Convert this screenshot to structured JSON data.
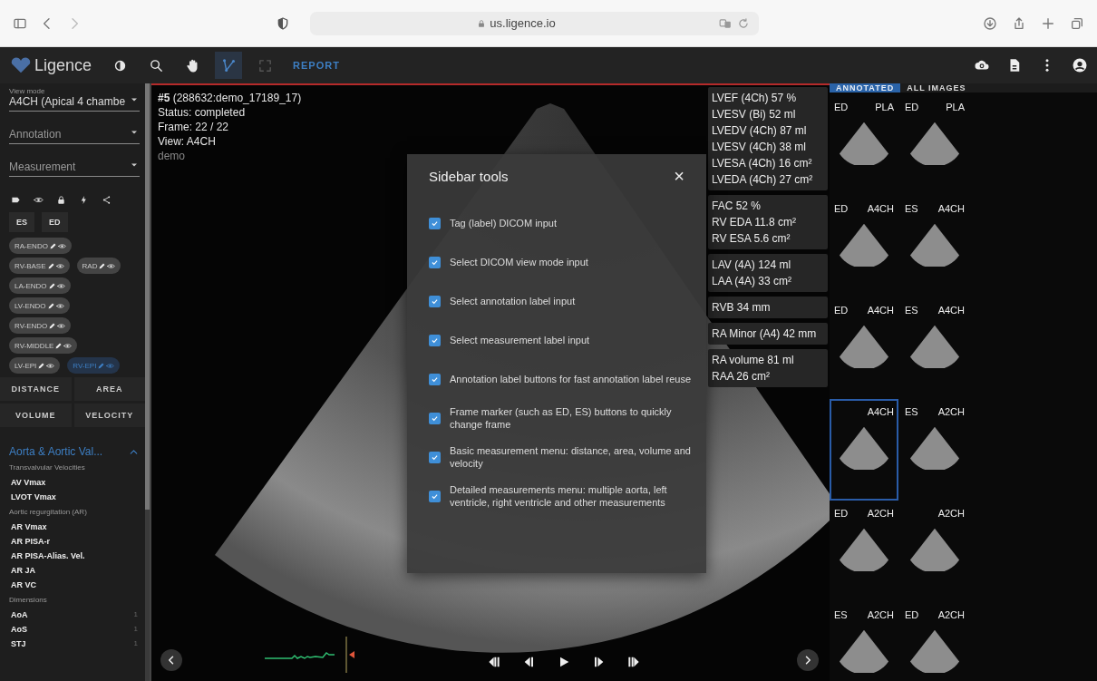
{
  "browser": {
    "address": "us.ligence.io"
  },
  "toolbar": {
    "logo": "Ligence",
    "tools": [
      {
        "kind": "contrast",
        "selected": false,
        "disabled": false
      },
      {
        "kind": "zoom",
        "selected": false,
        "disabled": false
      },
      {
        "kind": "hand",
        "selected": false,
        "disabled": false
      },
      {
        "kind": "polyline",
        "selected": true,
        "disabled": false
      },
      {
        "kind": "expand",
        "selected": false,
        "disabled": true
      }
    ],
    "report": "REPORT"
  },
  "sidebar": {
    "view_mode": {
      "label": "View mode",
      "value": "A4CH (Apical 4 chambe"
    },
    "annotation": {
      "placeholder": "Annotation"
    },
    "measurement": {
      "placeholder": "Measurement"
    },
    "frame_buttons": [
      "ES",
      "ED"
    ],
    "chip_rows": [
      [
        {
          "label": "RA-ENDO",
          "selected": false
        }
      ],
      [
        {
          "label": "RV-BASE",
          "selected": false
        },
        {
          "label": "RAD",
          "selected": false
        }
      ],
      [
        {
          "label": "LA-ENDO",
          "selected": false
        }
      ],
      [
        {
          "label": "LV-ENDO",
          "selected": false
        }
      ],
      [
        {
          "label": "RV-ENDO",
          "selected": false
        }
      ],
      [
        {
          "label": "RV-MIDDLE",
          "selected": false
        }
      ],
      [
        {
          "label": "LV-EPI",
          "selected": false
        },
        {
          "label": "RV-EPI",
          "selected": true
        }
      ]
    ],
    "measure_buttons": [
      "DISTANCE",
      "AREA",
      "VOLUME",
      "VELOCITY"
    ],
    "section": {
      "title": "Aorta & Aortic Val...",
      "expanded": true,
      "groups": [
        {
          "title": "Transvalvular Velocities",
          "items": [
            {
              "label": "AV Vmax"
            },
            {
              "label": "LVOT Vmax"
            }
          ]
        },
        {
          "title": "Aortic regurgitation (AR)",
          "items": [
            {
              "label": "AR Vmax"
            },
            {
              "label": "AR PISA-r"
            },
            {
              "label": "AR PISA-Alias. Vel."
            },
            {
              "label": "AR JA"
            },
            {
              "label": "AR VC"
            }
          ]
        },
        {
          "title": "Dimensions",
          "items": [
            {
              "label": "AoA",
              "count": "1"
            },
            {
              "label": "AoS",
              "count": "1"
            },
            {
              "label": "STJ",
              "count": "1"
            }
          ]
        }
      ]
    }
  },
  "viewer": {
    "info": [
      "**#5** (288632:demo_17189_17)",
      "Status: completed",
      "Frame: 22 / 22",
      "View: A4CH"
    ],
    "tag": "demo",
    "metrics": [
      [
        "LVEF (4Ch) 57 %",
        "LVESV (Bi) 52 ml",
        "LVEDV (4Ch) 87 ml",
        "LVESV (4Ch) 38 ml",
        "LVESA (4Ch) 16 cm²",
        "LVEDA (4Ch) 27 cm²"
      ],
      [
        "FAC 52 %",
        "RV EDA 11.8 cm²",
        "RV ESA 5.6 cm²"
      ],
      [
        "LAV (4A) 124 ml",
        "LAA (4A) 33 cm²"
      ],
      [
        "RVB 34 mm"
      ],
      [
        "RA Minor (A4) 42 mm"
      ],
      [
        "RA volume 81 ml",
        "RAA 26 cm²"
      ]
    ]
  },
  "dialog": {
    "title": "Sidebar tools",
    "close": "×",
    "options": [
      {
        "label": "Tag (label) DICOM input",
        "checked": true
      },
      {
        "label": "Select DICOM view mode input",
        "checked": true
      },
      {
        "label": "Select annotation label input",
        "checked": true
      },
      {
        "label": "Select measurement label input",
        "checked": true
      },
      {
        "label": "Annotation label buttons for fast annotation label reuse",
        "checked": true
      },
      {
        "label": "Frame marker (such as ED, ES) buttons to quickly change frame",
        "checked": true
      },
      {
        "label": "Basic measurement menu: distance, area, volume and velocity",
        "checked": true
      },
      {
        "label": "Detailed measurements menu: multiple aorta, left ventricle, right ventricle and other measurements",
        "checked": true
      }
    ]
  },
  "gallery": {
    "tabs": [
      {
        "label": "ANNOTATED",
        "selected": true
      },
      {
        "label": "ALL IMAGES",
        "selected": false
      }
    ],
    "thumbnails": [
      {
        "marker": "ED",
        "view": "PLA",
        "selected": false
      },
      {
        "marker": "ED",
        "view": "PLA",
        "selected": false
      },
      {
        "marker": "ED",
        "view": "A4CH",
        "selected": false
      },
      {
        "marker": "ES",
        "view": "A4CH",
        "selected": false
      },
      {
        "marker": "ED",
        "view": "A4CH",
        "selected": false
      },
      {
        "marker": "ES",
        "view": "A4CH",
        "selected": false
      },
      {
        "view": "A4CH",
        "selected": true
      },
      {
        "marker": "ES",
        "view": "A2CH",
        "selected": false
      },
      {
        "marker": "ED",
        "view": "A2CH",
        "selected": false
      },
      {
        "view": "A2CH",
        "selected": false
      },
      {
        "marker": "ES",
        "view": "A2CH",
        "selected": false
      },
      {
        "marker": "ED",
        "view": "A2CH",
        "selected": false
      }
    ]
  }
}
